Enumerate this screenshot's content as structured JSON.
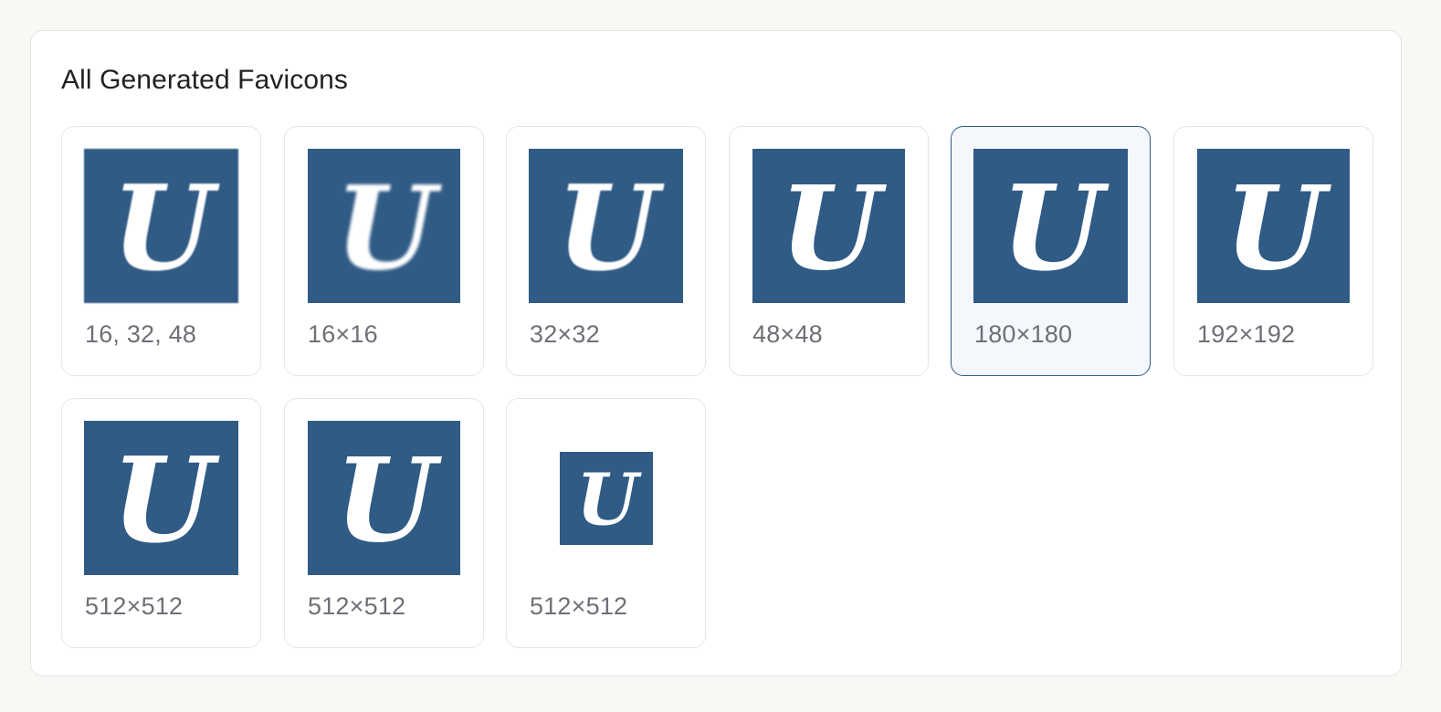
{
  "panel": {
    "title": "All Generated Favicons"
  },
  "favicons": [
    {
      "label": "16, 32, 48",
      "letter": "U",
      "selected": false
    },
    {
      "label": "16×16",
      "letter": "U",
      "selected": false
    },
    {
      "label": "32×32",
      "letter": "U",
      "selected": false
    },
    {
      "label": "48×48",
      "letter": "U",
      "selected": false
    },
    {
      "label": "180×180",
      "letter": "U",
      "selected": true
    },
    {
      "label": "192×192",
      "letter": "U",
      "selected": false
    },
    {
      "label": "512×512",
      "letter": "U",
      "selected": false
    },
    {
      "label": "512×512",
      "letter": "U",
      "selected": false
    },
    {
      "label": "512×512",
      "letter": "U",
      "selected": false
    }
  ],
  "colors": {
    "icon_background": "#2f5b85",
    "icon_letter": "#ffffff",
    "selected_border": "#2f5b83",
    "selected_background": "#f4f8fd",
    "label_text": "#6d7076",
    "page_background": "#f8f9f5"
  }
}
